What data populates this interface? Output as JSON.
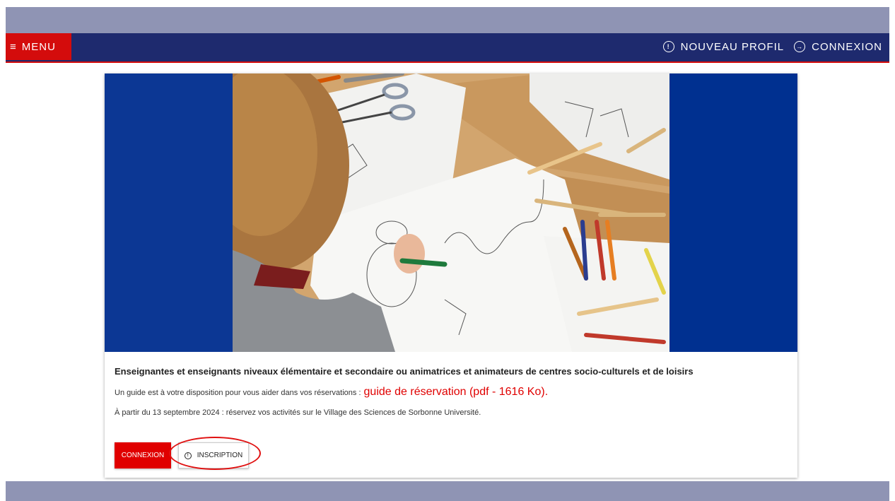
{
  "header": {
    "menu_label": "MENU",
    "menu_icon": "≡",
    "new_profile_label": "NOUVEAU PROFIL",
    "login_label": "CONNEXION",
    "new_profile_icon_glyph": "!",
    "login_icon_glyph": "→"
  },
  "colors": {
    "navbar": "#1e2a6e",
    "accent_red": "#d40c0c",
    "frame_band": "#8f94b4",
    "hero_blue": "#0c3794"
  },
  "card": {
    "title": "Enseignantes et enseignants niveaux élémentaire et secondaire ou animatrices et animateurs de centres socio-culturels et de loisirs",
    "guide_intro": "Un guide est à votre disposition pour vous aider dans vos réservations :",
    "guide_link": "guide de réservation (pdf - 1616 Ko).",
    "date_notice": "À partir du 13 septembre 2024 : réservez vos activités sur le Village des Sciences de Sorbonne Université.",
    "connexion_button": "CONNEXION",
    "inscription_button": "INSCRIPTION",
    "inscription_icon_glyph": "!"
  }
}
